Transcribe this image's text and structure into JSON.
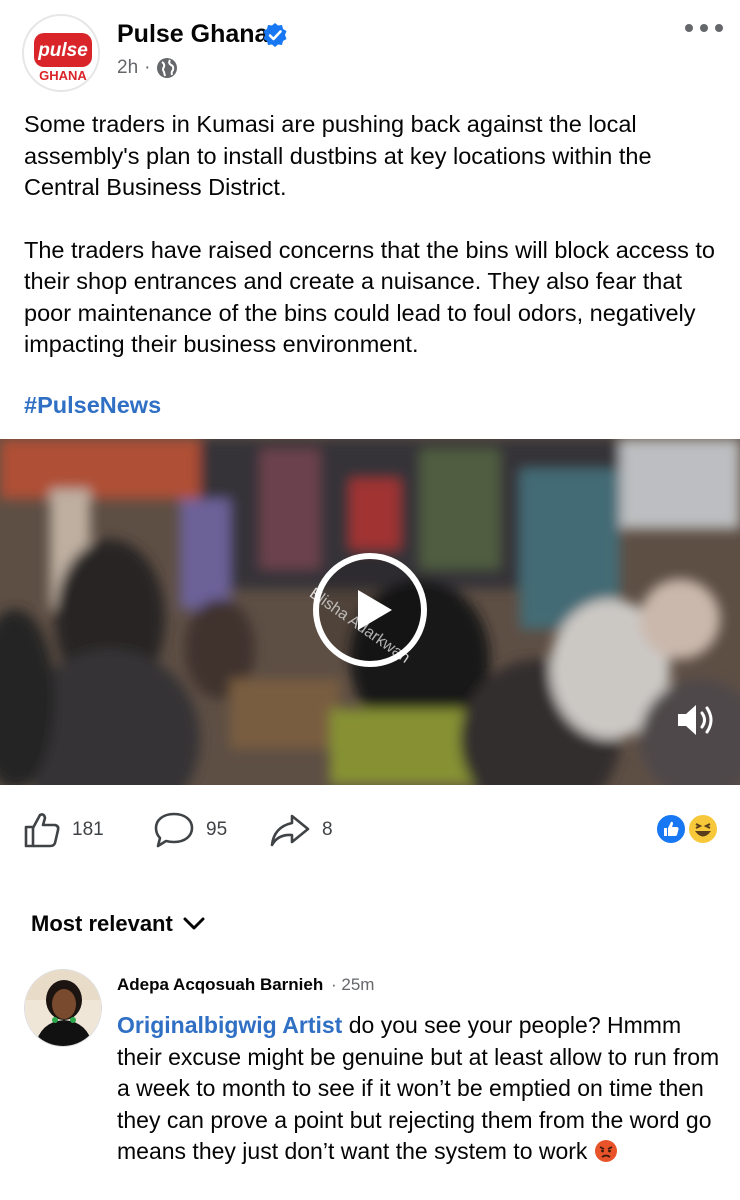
{
  "header": {
    "page_name": "Pulse Ghana",
    "logo_text_top": "pulse",
    "logo_text_bottom": "GHANA",
    "time": "2h",
    "separator": "·",
    "privacy_icon": "globe-icon",
    "more_icon": "more-horizontal-icon"
  },
  "post": {
    "paragraph1": "Some traders in Kumasi are pushing back against the local assembly's plan to install dustbins at key locations within the Central Business District.",
    "paragraph2": "The traders have raised concerns that the bins will block access to their shop entrances and create a nuisance. They also fear that poor maintenance of the bins could lead to foul odors, negatively impacting their business environment.",
    "hashtag": "#PulseNews"
  },
  "video": {
    "watermark": "Elisha Adarkwah",
    "play_icon": "play-icon",
    "volume_icon": "volume-icon"
  },
  "actions": {
    "like_count": "181",
    "comment_count": "95",
    "share_count": "8",
    "reactions": [
      "like-reaction-icon",
      "haha-reaction-icon"
    ]
  },
  "comments_sort": {
    "label": "Most relevant"
  },
  "comment": {
    "author": "Adepa Acqosuah Barnieh",
    "time": "· 25m",
    "mention": "Originalbigwig Artist",
    "text": " do you see your people? Hmmm their excuse might be genuine but at least allow to run from a week to month to see if it won’t be emptied on time then they can prove a point but rejecting them from the word go means they just don’t want the system to work "
  },
  "colors": {
    "link_blue": "#2f6fc4",
    "secondary_text": "#65676b",
    "verified_blue": "#1877f2",
    "brand_red": "#d9252a"
  }
}
